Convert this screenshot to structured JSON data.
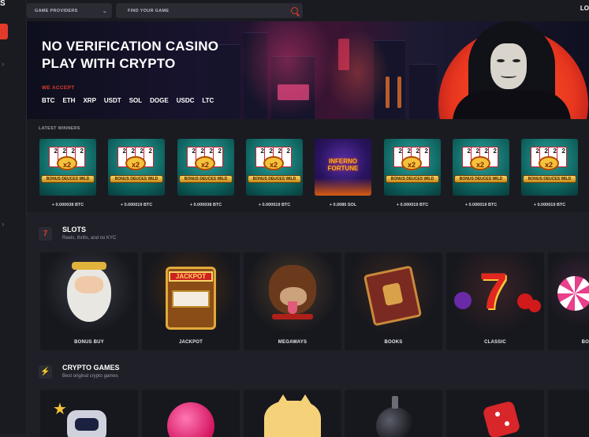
{
  "header": {
    "providers_label": "GAME PROVIDERS",
    "search_placeholder": "FIND YOUR GAME",
    "login_label": "LO"
  },
  "hero": {
    "title_line1": "NO VERIFICATION CASINO",
    "title_line2": "PLAY WITH CRYPTO",
    "accept_label": "WE ACCEPT",
    "coins": [
      "BTC",
      "ETH",
      "XRP",
      "USDT",
      "SOL",
      "DOGE",
      "USDC",
      "LTC"
    ]
  },
  "winners": {
    "label": "LATEST WINNERS",
    "items": [
      {
        "game": "BONUS DEUCES WILD",
        "amount": "+ 0.000038 BTC"
      },
      {
        "game": "BONUS DEUCES WILD",
        "amount": "+ 0.000019 BTC"
      },
      {
        "game": "BONUS DEUCES WILD",
        "amount": "+ 0.000038 BTC"
      },
      {
        "game": "BONUS DEUCES WILD",
        "amount": "+ 0.000019 BTC"
      },
      {
        "game": "INFERNO FORTUNE",
        "amount": "+ 0.0080 SOL"
      },
      {
        "game": "BONUS DEUCES WILD",
        "amount": "+ 0.000019 BTC"
      },
      {
        "game": "BONUS DEUCES WILD",
        "amount": "+ 0.000019 BTC"
      },
      {
        "game": "BONUS DEUCES WILD",
        "amount": "+ 0.000019 BTC"
      }
    ]
  },
  "slots": {
    "title": "SLOTS",
    "subtitle": "Reels, thrills, and no KYC",
    "tiles": [
      "BONUS BUY",
      "JACKPOT",
      "MEGAWAYS",
      "BOOKS",
      "CLASSIC",
      "BO"
    ]
  },
  "crypto": {
    "title": "CRYPTO GAMES",
    "subtitle": "Best original crypto games"
  },
  "colors": {
    "accent": "#e33a2c",
    "background": "#1f2027",
    "panel": "#1a1b21"
  }
}
